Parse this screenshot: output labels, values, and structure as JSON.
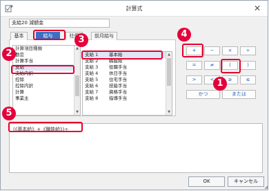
{
  "window": {
    "title": "計算式",
    "close": "✕"
  },
  "item": {
    "name": "支給20 減額金"
  },
  "tabs": [
    {
      "label": "基本",
      "active": false
    },
    {
      "label": "給与",
      "active": true
    },
    {
      "label": "社保",
      "active": false
    },
    {
      "label": "前月給与",
      "active": false
    }
  ],
  "category_list": {
    "header": "計算項目種類",
    "items": [
      "勤怠",
      "計算手当",
      "支給",
      "支給内訳",
      "控除",
      "控除内訳",
      "計算",
      "事業主"
    ],
    "selected": "支給"
  },
  "item_list": {
    "rows": [
      {
        "code": "支給 1",
        "name": "基本給",
        "selected": true
      },
      {
        "code": "支給 2",
        "name": "職能給"
      },
      {
        "code": "支給 3",
        "name": "役職手当"
      },
      {
        "code": "支給 4",
        "name": "休日手当"
      },
      {
        "code": "支給 5",
        "name": "住宅手当"
      },
      {
        "code": "支給 6",
        "name": "技能手当"
      },
      {
        "code": "支給 7",
        "name": "資格手当"
      },
      {
        "code": "支給 8",
        "name": "指導手当"
      }
    ]
  },
  "operators": {
    "row1": [
      "+",
      "−",
      "×",
      "÷"
    ],
    "row2": [
      "=",
      "≠",
      "(",
      ")"
    ],
    "row3": [
      ">",
      "<",
      "≥",
      "≤"
    ],
    "and_label": "かつ",
    "or_label": "または"
  },
  "formula": {
    "text": "(《基本給》+《職能給》)÷"
  },
  "buttons": {
    "ok": "OK",
    "cancel": "キャンセル"
  },
  "annotations": [
    "1",
    "2",
    "3",
    "4",
    "5"
  ],
  "colors": {
    "accent": "#e4002b",
    "tab_active": "#3a6fc4"
  }
}
